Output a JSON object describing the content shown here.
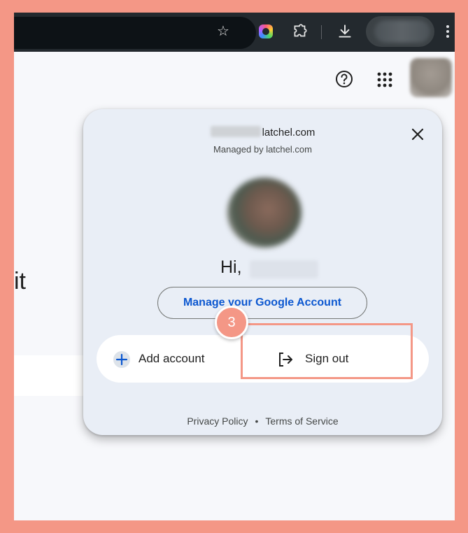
{
  "browser": {
    "icons": [
      "star-icon",
      "extension-colorful-icon",
      "puzzle-icon",
      "download-icon",
      "kebab-menu-icon"
    ]
  },
  "page": {
    "left_text": "it",
    "icons": [
      "help-icon",
      "apps-grid-icon"
    ]
  },
  "account_panel": {
    "email_suffix": "latchel.com",
    "managed_by": "Managed by latchel.com",
    "greeting": "Hi,",
    "manage_button": "Manage your Google Account",
    "add_account": "Add account",
    "sign_out": "Sign out",
    "privacy_link": "Privacy Policy",
    "separator": "•",
    "terms_link": "Terms of Service"
  },
  "annotation": {
    "step_number": "3",
    "highlight_color": "#f49786"
  },
  "colors": {
    "frame_background": "#f49786",
    "toolbar": "#23292e",
    "panel_background": "#e9eef6",
    "link_blue": "#0b57d0"
  }
}
